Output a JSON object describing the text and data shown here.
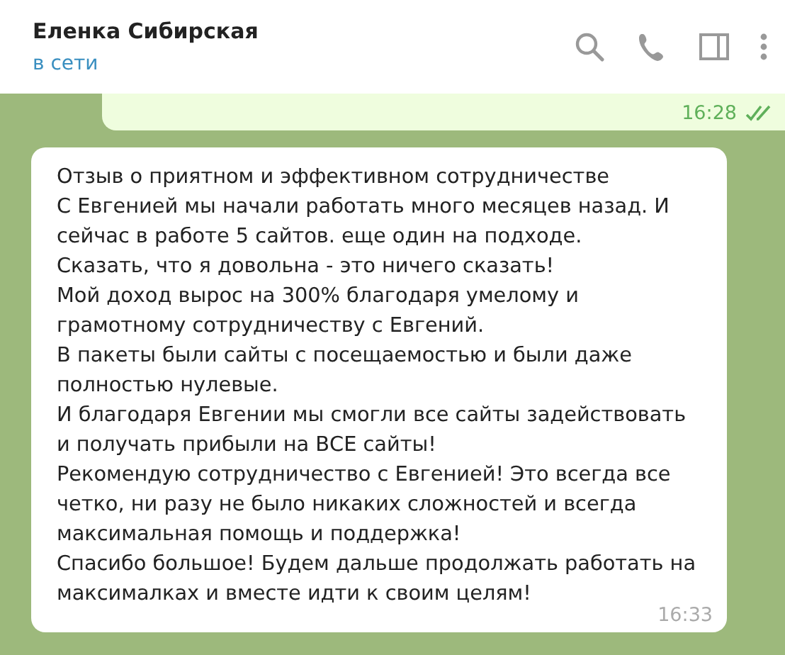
{
  "header": {
    "name": "Еленка Сибирская",
    "status": "в сети"
  },
  "messages": [
    {
      "kind": "outgoing",
      "time": "16:28",
      "read": true
    },
    {
      "kind": "incoming",
      "text": "Отзыв о приятном и эффективном сотрудничестве\nС Евгенией мы начали работать много месяцев назад. И\nсейчас в работе 5 сайтов. еще один на подходе.\nСказать, что я довольна - это ничего сказать!\nМой доход вырос на 300% благодаря умелому и\nграмотному сотрудничеству с Евгений.\nВ пакеты были сайты с посещаемостью и были даже\nполностью нулевые.\nИ благодаря Евгении мы смогли все сайты задействовать\nи получать прибыли на ВСЕ сайты!\nРекомендую сотрудничество с Евгенией! Это всегда все\nчетко, ни разу не было никаких сложностей и всегда\nмаксимальная помощь и поддержка!\nСпасибо большое! Будем дальше продолжать работать на\nмаксималках и вместе идти к своим целям!",
      "time": "16:33"
    }
  ]
}
